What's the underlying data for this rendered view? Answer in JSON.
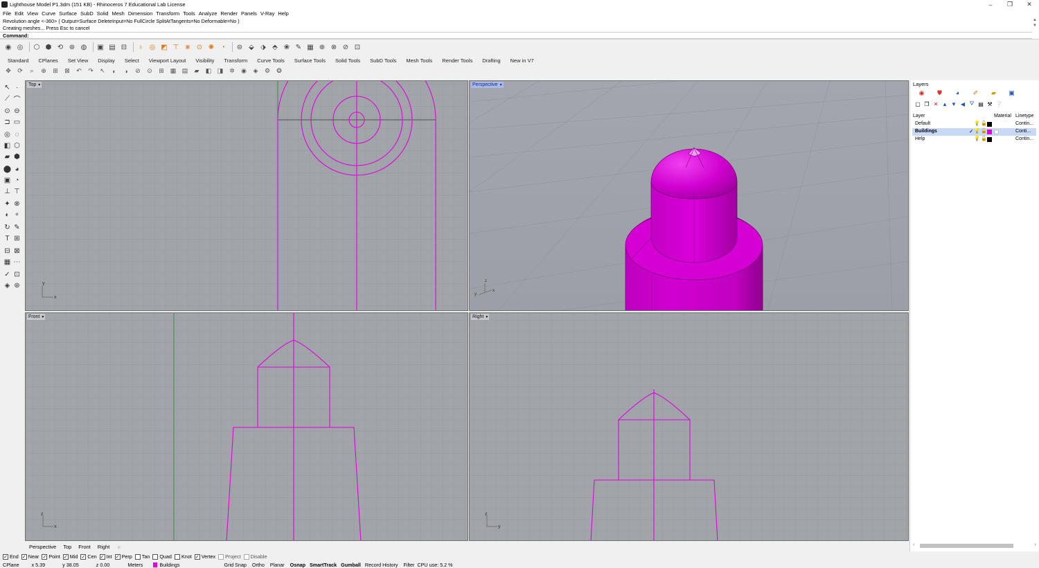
{
  "window": {
    "title": "Lighthouse Model P1.3dm (151 KB) - Rhinoceros 7 Educational Lab License",
    "controls": [
      "–",
      "❐",
      "✕"
    ]
  },
  "menu": [
    "File",
    "Edit",
    "View",
    "Curve",
    "Surface",
    "SubD",
    "Solid",
    "Mesh",
    "Dimension",
    "Transform",
    "Tools",
    "Analyze",
    "Render",
    "Panels",
    "V-Ray",
    "Help"
  ],
  "command": {
    "history": [
      "Revolution angle <-360> ( Output=Surface  DeleteInput=No  FullCircle  SplitAtTangents=No  Deformable=No )",
      "Creating meshes... Press Esc to cancel"
    ],
    "prompt": "Command:"
  },
  "toolbar_tabs": [
    "Standard",
    "CPlanes",
    "Set View",
    "Display",
    "Select",
    "Viewport Layout",
    "Visibility",
    "Transform",
    "Curve Tools",
    "Surface Tools",
    "Solid Tools",
    "SubD Tools",
    "Mesh Tools",
    "Render Tools",
    "Drafting",
    "New in V7"
  ],
  "viewports": {
    "top": "Top",
    "perspective": "Perspective",
    "front": "Front",
    "right": "Right"
  },
  "viewport_tabs": [
    "Perspective",
    "Top",
    "Front",
    "Right"
  ],
  "layers_panel": {
    "title": "Layers",
    "columns": {
      "layer": "Layer",
      "material": "Material",
      "linetype": "Linetype"
    },
    "rows": [
      {
        "name": "Default",
        "color": "#000000",
        "linetype": "Contin...",
        "current": false
      },
      {
        "name": "Buildings",
        "color": "#e000e0",
        "linetype": "Conti...",
        "current": true
      },
      {
        "name": "Help",
        "color": "#000000",
        "linetype": "Contin...",
        "current": false
      }
    ]
  },
  "osnaps": [
    {
      "label": "End",
      "checked": true
    },
    {
      "label": "Near",
      "checked": true
    },
    {
      "label": "Point",
      "checked": true
    },
    {
      "label": "Mid",
      "checked": true
    },
    {
      "label": "Cen",
      "checked": true
    },
    {
      "label": "Int",
      "checked": true
    },
    {
      "label": "Perp",
      "checked": true
    },
    {
      "label": "Tan",
      "checked": false
    },
    {
      "label": "Quad",
      "checked": false
    },
    {
      "label": "Knot",
      "checked": false
    },
    {
      "label": "Vertex",
      "checked": true
    },
    {
      "label": "Project",
      "checked": false,
      "disabled": true
    },
    {
      "label": "Disable",
      "checked": false,
      "disabled": true
    }
  ],
  "status": {
    "cplane": "CPlane",
    "x": "x 5.39",
    "y": "y 38.05",
    "z": "z 0.00",
    "units": "Meters",
    "layer": "Buildings",
    "modes": [
      "Grid Snap",
      "Ortho",
      "Planar",
      "Osnap",
      "SmartTrack",
      "Gumball",
      "Record History",
      "Filter"
    ],
    "cpu": "CPU use: 5.2 %"
  },
  "colors": {
    "object": "#e000e0",
    "viewport_bg": "#a1a4a9",
    "active_label": "#aab9e8"
  }
}
